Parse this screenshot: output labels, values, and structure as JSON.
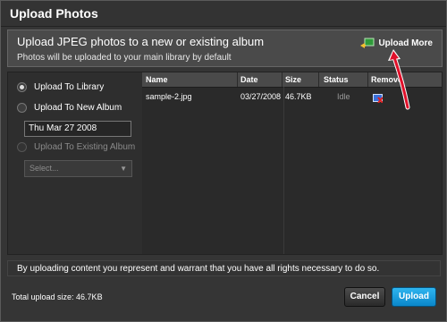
{
  "dialog": {
    "title": "Upload Photos",
    "heading": "Upload JPEG photos to a new or existing album",
    "subheading": "Photos will be uploaded to your main library by default",
    "upload_more_label": "Upload More"
  },
  "options": {
    "library_label": "Upload To Library",
    "new_album_label": "Upload To New Album",
    "new_album_value": "Thu Mar 27 2008",
    "existing_album_label": "Upload To Existing Album",
    "existing_album_select": "Select..."
  },
  "table": {
    "columns": [
      "Name",
      "Date",
      "Size",
      "Status",
      "Remove"
    ],
    "rows": [
      {
        "name": "sample-2.jpg",
        "date": "03/27/2008",
        "size": "46.7KB",
        "status": "Idle"
      }
    ]
  },
  "footer": {
    "agreement": "By uploading content you represent and warrant that you have all rights necessary to do so.",
    "total": "Total upload size: 46.7KB",
    "cancel_label": "Cancel",
    "upload_label": "Upload"
  },
  "colors": {
    "accent": "#1ea6e6",
    "annotation": "#e0102a"
  },
  "icons": {
    "upload_more": "add-photo-icon",
    "remove": "remove-photo-icon",
    "annotation": "red-arrow-annotation"
  }
}
